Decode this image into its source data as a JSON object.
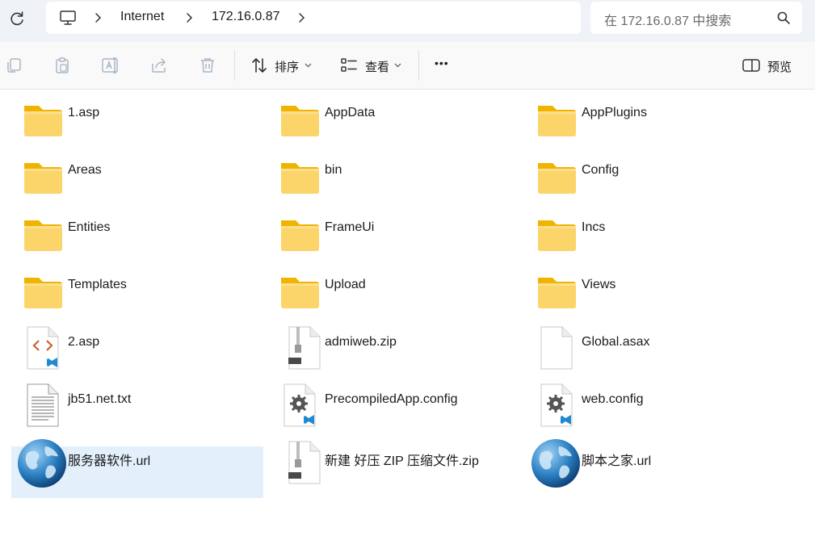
{
  "address": {
    "crumbs": [
      "Internet",
      "172.16.0.87"
    ]
  },
  "search": {
    "placeholder": "在 172.16.0.87 中搜索"
  },
  "toolbar": {
    "sort_label": "排序",
    "view_label": "查看",
    "more_label": "•••",
    "preview_label": "预览"
  },
  "files": [
    {
      "name": "1.asp",
      "type": "folder"
    },
    {
      "name": "AppData",
      "type": "folder"
    },
    {
      "name": "AppPlugins",
      "type": "folder"
    },
    {
      "name": "Areas",
      "type": "folder"
    },
    {
      "name": "bin",
      "type": "folder"
    },
    {
      "name": "Config",
      "type": "folder"
    },
    {
      "name": "Entities",
      "type": "folder"
    },
    {
      "name": "FrameUi",
      "type": "folder"
    },
    {
      "name": "Incs",
      "type": "folder"
    },
    {
      "name": "Templates",
      "type": "folder"
    },
    {
      "name": "Upload",
      "type": "folder"
    },
    {
      "name": "Views",
      "type": "folder"
    },
    {
      "name": "2.asp",
      "type": "code"
    },
    {
      "name": "admiweb.zip",
      "type": "zip"
    },
    {
      "name": "Global.asax",
      "type": "blank"
    },
    {
      "name": "jb51.net.txt",
      "type": "text"
    },
    {
      "name": "PrecompiledApp.config",
      "type": "config"
    },
    {
      "name": "web.config",
      "type": "config"
    },
    {
      "name": "服务器软件.url",
      "type": "url",
      "selected": true
    },
    {
      "name": "新建 好压 ZIP 压缩文件.zip",
      "type": "zip"
    },
    {
      "name": "脚本之家.url",
      "type": "url"
    }
  ],
  "colors": {
    "folder_top": "#f6c343",
    "folder_body": "#fcd56a",
    "selection": "#e3f0fb",
    "accent": "#0078d4"
  }
}
